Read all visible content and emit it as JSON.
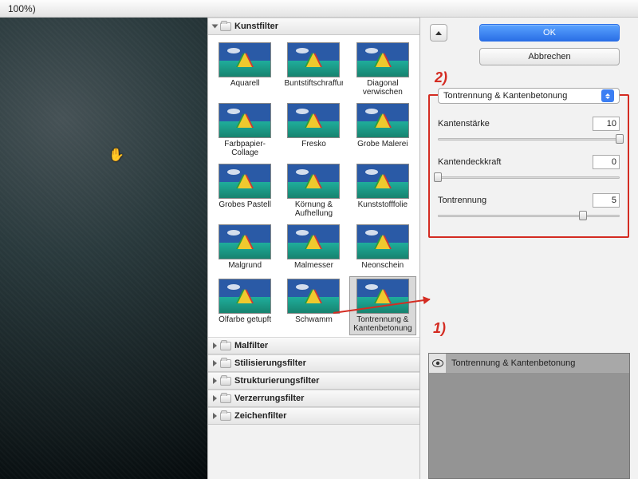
{
  "titlebar": {
    "zoom": "100%)"
  },
  "categories": {
    "open": {
      "label": "Kunstfilter"
    },
    "closed": [
      "Malfilter",
      "Stilisierungsfilter",
      "Strukturierungsfilter",
      "Verzerrungsfilter",
      "Zeichenfilter"
    ]
  },
  "thumbs": [
    "Aquarell",
    "Buntstiftschraffur",
    "Diagonal verwischen",
    "Farbpapier-Collage",
    "Fresko",
    "Grobe Malerei",
    "Grobes Pastell",
    "Körnung & Aufhellung",
    "Kunststofffolie",
    "Malgrund",
    "Malmesser",
    "Neonschein",
    "Ölfarbe getupft",
    "Schwamm",
    "Tontrennung & Kantenbetonung"
  ],
  "selected_thumb_index": 14,
  "buttons": {
    "ok": "OK",
    "cancel": "Abbrechen"
  },
  "filter_select": "Tontrennung & Kantenbetonung",
  "params": [
    {
      "label": "Kantenstärke",
      "value": "10",
      "pos": 100
    },
    {
      "label": "Kantendeckkraft",
      "value": "0",
      "pos": 0
    },
    {
      "label": "Tontrennung",
      "value": "5",
      "pos": 80
    }
  ],
  "annotations": {
    "one": "1)",
    "two": "2)"
  },
  "layer": {
    "name": "Tontrennung & Kantenbetonung"
  }
}
